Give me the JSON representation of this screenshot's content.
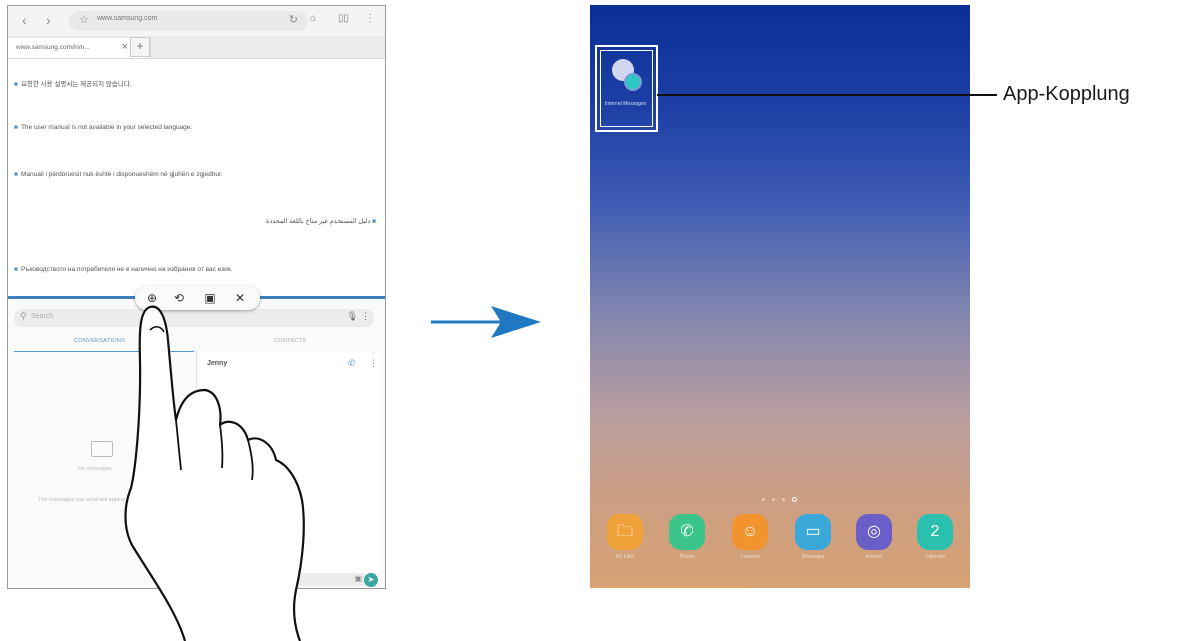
{
  "left_phone": {
    "browser": {
      "back_icon": "‹",
      "forward_icon": "›",
      "url": "www.samsung.com",
      "home_icon": "home-icon",
      "bookmark_icon": "bookmark-icon",
      "more_icon": "more-vertical-icon"
    },
    "tabs": [
      {
        "title": "www.samsung.com/in/n..."
      }
    ],
    "web_lines": [
      "요청한 사용 설명서는 제공되지 않습니다.",
      "The user manual is not available in your selected language.",
      "Manuali i përdoruesit nuk është i disponueshëm në gjuhën e zgjedhur.",
      "دليل المستخدم غير متاح باللغة المحددة",
      "Ръководството на потребителя не е налично на избрания от вас език."
    ],
    "split_controls": {
      "icons": [
        "add-app-pair-icon",
        "swap-icon",
        "window-icon",
        "close-icon"
      ]
    },
    "messages": {
      "search_placeholder": "Search",
      "tab_conversations": "CONVERSATIONS",
      "tab_contacts": "CONTACTS",
      "contact_name": "Jenny",
      "empty_title": "No messages",
      "empty_sub": "The messages you send will appear here."
    }
  },
  "right_phone": {
    "app_pair_label": "Internet Messages",
    "dock": [
      {
        "label": "My Files",
        "color": "#f0a23a",
        "icon": "folder-icon"
      },
      {
        "label": "Phone",
        "color": "#3cc58a",
        "icon": "phone-icon"
      },
      {
        "label": "Contacts",
        "color": "#f2932e",
        "icon": "contacts-icon"
      },
      {
        "label": "Messages",
        "color": "#3aa8d8",
        "icon": "messages-icon"
      },
      {
        "label": "Internet",
        "color": "#6a5fc9",
        "icon": "internet-icon"
      },
      {
        "label": "Calendar",
        "color": "#2bbfb0",
        "icon": "calendar-icon",
        "glyph": "2"
      }
    ],
    "page_count": 4,
    "active_page": 4
  },
  "callout": {
    "label": "App-Kopplung"
  }
}
